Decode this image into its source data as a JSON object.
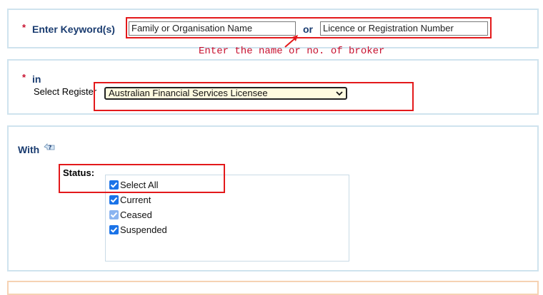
{
  "keyword_section": {
    "required_mark": "*",
    "label": "Enter Keyword(s)",
    "name_input_value": "Family or Organisation Name",
    "or_label": "or",
    "number_input_value": "Licence or Registration Number"
  },
  "annotation_text": "Enter the name or no. of broker",
  "register_section": {
    "required_mark": "*",
    "in_label": "in",
    "select_label": "Select Register",
    "selected_value": "Australian Financial Services Licensee"
  },
  "with_section": {
    "label": "With",
    "help_icon": "question-help-icon",
    "status_label": "Status:",
    "options": [
      {
        "label": "Select All",
        "checked": true
      },
      {
        "label": "Current",
        "checked": true
      },
      {
        "label": "Ceased",
        "checked": true
      },
      {
        "label": "Suspended",
        "checked": true
      }
    ]
  },
  "colors": {
    "accent": "#1a73e8",
    "highlight": "#e3191b",
    "label": "#1a3c70",
    "panel_border": "#cfe3ee"
  }
}
